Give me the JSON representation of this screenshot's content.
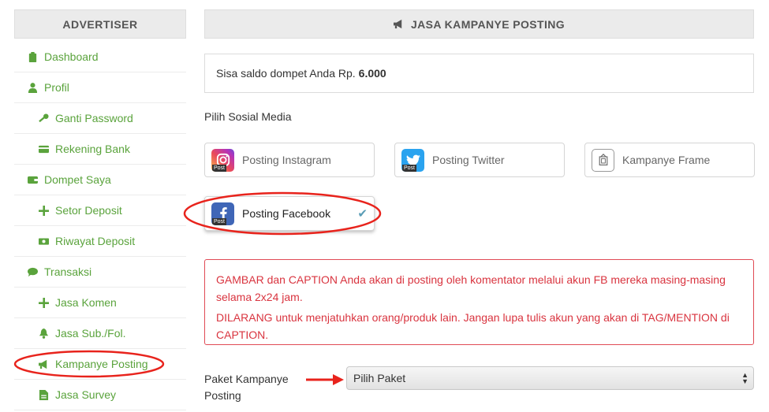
{
  "sidebar": {
    "title": "ADVERTISER",
    "items": [
      {
        "label": "Dashboard",
        "icon": "clipboard-icon",
        "level": "top"
      },
      {
        "label": "Profil",
        "icon": "user-icon",
        "level": "top"
      },
      {
        "label": "Ganti Password",
        "icon": "key-icon",
        "level": "sub"
      },
      {
        "label": "Rekening Bank",
        "icon": "credit-card-icon",
        "level": "sub"
      },
      {
        "label": "Dompet Saya",
        "icon": "wallet-icon",
        "level": "top"
      },
      {
        "label": "Setor Deposit",
        "icon": "plus-icon",
        "level": "sub"
      },
      {
        "label": "Riwayat Deposit",
        "icon": "money-icon",
        "level": "sub"
      },
      {
        "label": "Transaksi",
        "icon": "comment-icon",
        "level": "top"
      },
      {
        "label": "Jasa Komen",
        "icon": "plus-icon",
        "level": "sub"
      },
      {
        "label": "Jasa Sub./Fol.",
        "icon": "bell-icon",
        "level": "sub"
      },
      {
        "label": "Kampanye Posting",
        "icon": "megaphone-icon",
        "level": "sub"
      },
      {
        "label": "Jasa Survey",
        "icon": "file-icon",
        "level": "sub"
      }
    ]
  },
  "main": {
    "title": "JASA KAMPANYE POSTING",
    "balance_text": "Sisa saldo dompet Anda Rp.",
    "balance_value": "6.000",
    "pick_label": "Pilih Sosial Media",
    "social_options": [
      {
        "label": "Posting Instagram",
        "icon": "instagram-icon",
        "badge": "Post"
      },
      {
        "label": "Posting Twitter",
        "icon": "twitter-icon",
        "badge": "Post"
      },
      {
        "label": "Kampanye Frame",
        "icon": "frame-icon"
      },
      {
        "label": "Posting Facebook",
        "icon": "facebook-icon",
        "badge": "Post",
        "selected": true
      }
    ],
    "alert_line1": "GAMBAR dan CAPTION Anda akan di posting oleh komentator melalui akun FB mereka masing-masing selama 2x24 jam.",
    "alert_line2": "DILARANG untuk menjatuhkan orang/produk lain. Jangan lupa tulis akun yang akan di TAG/MENTION di CAPTION.",
    "paket_label": "Paket Kampanye Posting",
    "paket_select_value": "Pilih Paket"
  },
  "colors": {
    "accent_green": "#5aa33c",
    "alert_red": "#d9343f",
    "annotation_red": "#e8231c"
  }
}
